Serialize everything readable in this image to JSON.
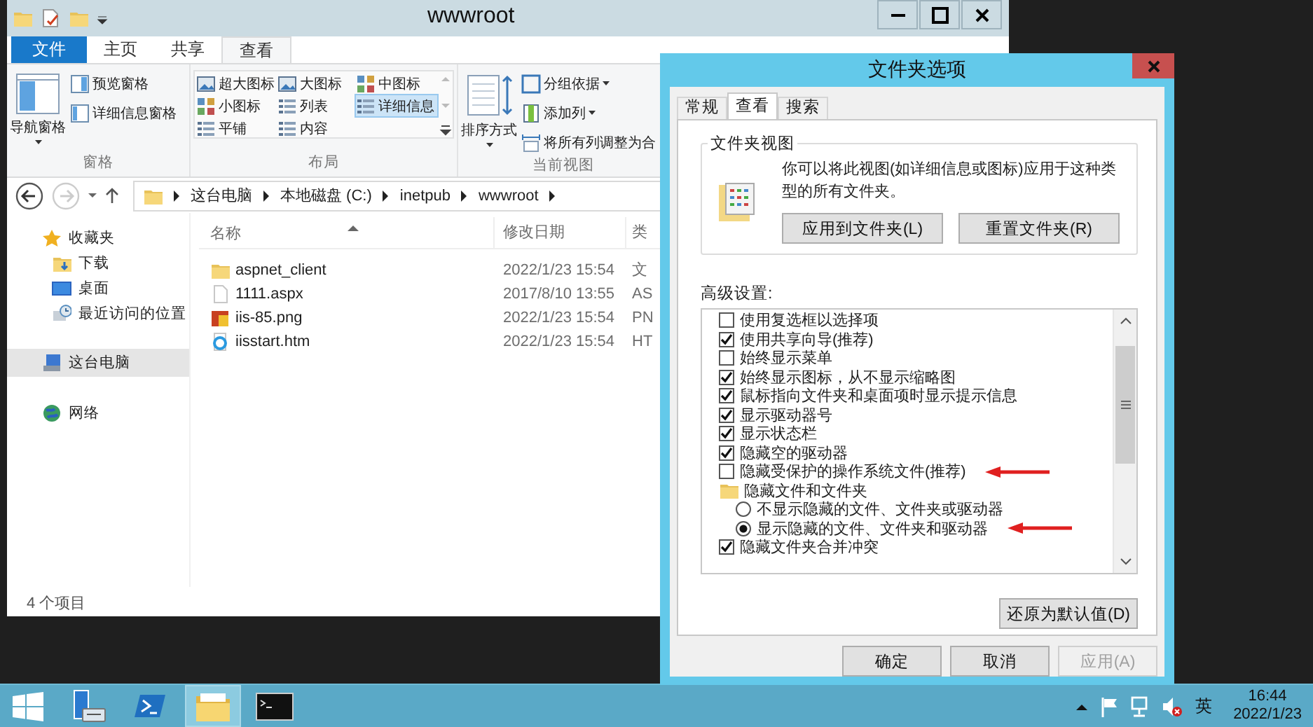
{
  "explorer": {
    "title": "wwwroot",
    "ribbon_tabs": [
      {
        "label": "文件",
        "kind": "file",
        "selected": false
      },
      {
        "label": "主页",
        "kind": "tab",
        "selected": false
      },
      {
        "label": "共享",
        "kind": "tab",
        "selected": false
      },
      {
        "label": "查看",
        "kind": "tab",
        "selected": true
      }
    ],
    "ribbon_groups": [
      {
        "label": "窗格",
        "kind": "buttons",
        "items": [
          {
            "label": "导航窗格",
            "kind": "large",
            "dropdown": true,
            "selected": false
          },
          {
            "label": "预览窗格",
            "kind": "small",
            "dropdown": false,
            "selected": false
          },
          {
            "label": "详细信息窗格",
            "kind": "small",
            "dropdown": false,
            "selected": false
          }
        ]
      },
      {
        "label": "布局",
        "kind": "gallery",
        "items": [
          {
            "label": "超大图标",
            "selected": false
          },
          {
            "label": "大图标",
            "selected": false
          },
          {
            "label": "中图标",
            "selected": false
          },
          {
            "label": "小图标",
            "selected": false
          },
          {
            "label": "列表",
            "selected": false
          },
          {
            "label": "详细信息",
            "selected": true
          },
          {
            "label": "平铺",
            "selected": false
          },
          {
            "label": "内容",
            "selected": false
          }
        ]
      },
      {
        "label": "当前视图",
        "kind": "buttons",
        "items": [
          {
            "label": "排序方式",
            "kind": "large",
            "dropdown": true,
            "selected": false
          },
          {
            "label": "分组依据",
            "kind": "small",
            "dropdown": true,
            "selected": false
          },
          {
            "label": "添加列",
            "kind": "small",
            "dropdown": true,
            "selected": false
          },
          {
            "label": "将所有列调整为合",
            "kind": "small",
            "dropdown": false,
            "selected": false
          }
        ]
      }
    ],
    "address": [
      "这台电脑",
      "本地磁盘 (C:)",
      "inetpub",
      "wwwroot"
    ],
    "nav": [
      {
        "label": "收藏夹",
        "kind": "star",
        "selected": false,
        "children": [
          {
            "label": "下载",
            "kind": "download",
            "selected": false
          },
          {
            "label": "桌面",
            "kind": "desktop",
            "selected": false
          },
          {
            "label": "最近访问的位置",
            "kind": "recent",
            "selected": false
          }
        ]
      },
      {
        "label": "这台电脑",
        "kind": "pc",
        "selected": true
      },
      {
        "label": "网络",
        "kind": "network",
        "selected": false
      }
    ],
    "columns": [
      "名称",
      "修改日期",
      "类"
    ],
    "files": [
      {
        "kind": "folder",
        "name": "aspnet_client",
        "date": "2022/1/23 15:54",
        "type": "文"
      },
      {
        "kind": "file",
        "name": "1111.aspx",
        "date": "2017/8/10 13:55",
        "type": "AS"
      },
      {
        "kind": "image",
        "name": "iis-85.png",
        "date": "2022/1/23 15:54",
        "type": "PN"
      },
      {
        "kind": "web",
        "name": "iisstart.htm",
        "date": "2022/1/23 15:54",
        "type": "HT"
      }
    ],
    "status_bar": "4 个项目"
  },
  "dialog": {
    "title": "文件夹选项",
    "tabs": [
      {
        "label": "常规",
        "selected": false
      },
      {
        "label": "查看",
        "selected": true
      },
      {
        "label": "搜索",
        "selected": false
      }
    ],
    "folder_views": {
      "title": "文件夹视图",
      "description": "你可以将此视图(如详细信息或图标)应用于这种类型的所有文件夹。",
      "buttons": [
        "应用到文件夹(L)",
        "重置文件夹(R)"
      ]
    },
    "advanced_label": "高级设置:",
    "advanced": [
      {
        "kind": "checkbox",
        "label": "使用复选框以选择项",
        "checked": false,
        "marked": false
      },
      {
        "kind": "checkbox",
        "label": "使用共享向导(推荐)",
        "checked": true,
        "marked": false
      },
      {
        "kind": "checkbox",
        "label": "始终显示菜单",
        "checked": false,
        "marked": false
      },
      {
        "kind": "checkbox",
        "label": "始终显示图标，从不显示缩略图",
        "checked": true,
        "marked": false
      },
      {
        "kind": "checkbox",
        "label": "鼠标指向文件夹和桌面项时显示提示信息",
        "checked": true,
        "marked": false
      },
      {
        "kind": "checkbox",
        "label": "显示驱动器号",
        "checked": true,
        "marked": false
      },
      {
        "kind": "checkbox",
        "label": "显示状态栏",
        "checked": true,
        "marked": false
      },
      {
        "kind": "checkbox",
        "label": "隐藏空的驱动器",
        "checked": true,
        "marked": false
      },
      {
        "kind": "checkbox",
        "label": "隐藏受保护的操作系统文件(推荐)",
        "checked": false,
        "marked": true
      },
      {
        "kind": "folder",
        "label": "隐藏文件和文件夹",
        "marked": false,
        "children": [
          {
            "kind": "radio",
            "label": "不显示隐藏的文件、文件夹或驱动器",
            "selected": false,
            "marked": false
          },
          {
            "kind": "radio",
            "label": "显示隐藏的文件、文件夹和驱动器",
            "selected": true,
            "marked": true
          }
        ]
      },
      {
        "kind": "checkbox",
        "label": "隐藏文件夹合并冲突",
        "checked": true,
        "marked": false
      }
    ],
    "restore_button": "还原为默认值(D)",
    "footer_buttons": [
      {
        "label": "确定",
        "disabled": false
      },
      {
        "label": "取消",
        "disabled": false
      },
      {
        "label": "应用(A)",
        "disabled": true
      }
    ]
  },
  "taskbar": {
    "apps": [
      {
        "kind": "server",
        "active": false
      },
      {
        "kind": "powershell",
        "active": false
      },
      {
        "kind": "explorer",
        "active": true
      },
      {
        "kind": "cmd",
        "active": false
      }
    ],
    "ime": "英",
    "time": "16:44",
    "date": "2022/1/23"
  }
}
